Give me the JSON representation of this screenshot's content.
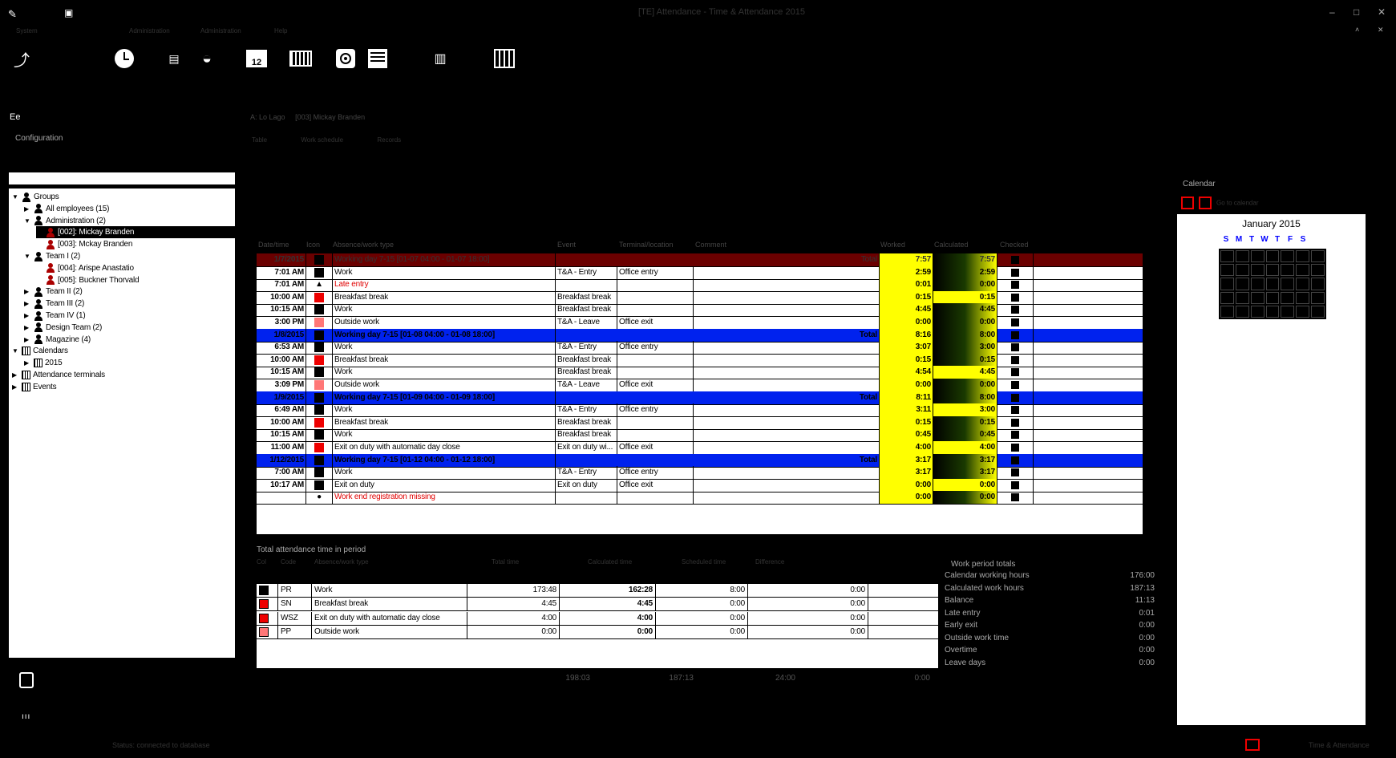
{
  "window": {
    "title": "[TE] Attendance - Time & Attendance 2015"
  },
  "menu": [
    "System",
    "Administration",
    "Administration",
    "Help"
  ],
  "nav": {
    "section": "Configuration",
    "breadcrumb_icon": "Ee",
    "page": "A: Lo Lago",
    "page2": "[003] Mickay Branden",
    "links": [
      "Table",
      "Work schedule",
      "Records"
    ]
  },
  "tree": [
    {
      "label": "Groups",
      "indent": 0,
      "icon": "person",
      "chev": "v"
    },
    {
      "label": "All employees (15)",
      "indent": 1,
      "icon": "person",
      "chev": ">"
    },
    {
      "label": "Administration (2)",
      "indent": 1,
      "icon": "person",
      "chev": "v"
    },
    {
      "label": "[002]: Mickay Branden",
      "indent": 2,
      "icon": "person-red",
      "sel": true
    },
    {
      "label": "[003]: Mckay Branden",
      "indent": 2,
      "icon": "person-red"
    },
    {
      "label": "Team I (2)",
      "indent": 1,
      "icon": "person",
      "chev": "v"
    },
    {
      "label": "[004]: Arispe Anastatio",
      "indent": 2,
      "icon": "person-red"
    },
    {
      "label": "[005]: Buckner Thorvald",
      "indent": 2,
      "icon": "person-red"
    },
    {
      "label": "Team II (2)",
      "indent": 1,
      "icon": "person",
      "chev": ">"
    },
    {
      "label": "Team III (2)",
      "indent": 1,
      "icon": "person",
      "chev": ">"
    },
    {
      "label": "Team IV (1)",
      "indent": 1,
      "icon": "person",
      "chev": ">"
    },
    {
      "label": "Design Team (2)",
      "indent": 1,
      "icon": "person",
      "chev": ">"
    },
    {
      "label": "Magazine (4)",
      "indent": 1,
      "icon": "person",
      "chev": ">"
    },
    {
      "label": "Calendars",
      "indent": 0,
      "icon": "calendar",
      "chev": "v"
    },
    {
      "label": "2015",
      "indent": 1,
      "icon": "calendar",
      "chev": ">"
    },
    {
      "label": "Attendance terminals",
      "indent": 0,
      "icon": "terminal",
      "chev": ">"
    },
    {
      "label": "Events",
      "indent": 0,
      "icon": "events",
      "chev": ">"
    }
  ],
  "records": {
    "columns": [
      "Date/time",
      "Icon",
      "Absence/work type",
      "Event",
      "Terminal/location",
      "Comment",
      "Worked",
      "Calculated",
      "Checked"
    ],
    "rows": [
      {
        "kind": "head-dark",
        "date": "1/7/2015",
        "type": "Working day 7-15 [01-07 04:00 - 01-07 18:00]",
        "total": "Total",
        "worked": "7:57",
        "calc": "7:57"
      },
      {
        "kind": "row",
        "time": "7:01 AM",
        "sq": "#000",
        "type": "Work",
        "event": "T&A - Entry",
        "loc": "Office entry",
        "worked": "2:59",
        "calc": "2:59"
      },
      {
        "kind": "row",
        "time": "7:01 AM",
        "sq": "tri",
        "type": "Late entry",
        "red": true,
        "worked": "0:01",
        "calc": "0:00"
      },
      {
        "kind": "row",
        "time": "10:00 AM",
        "sq": "#e00",
        "type": "Breakfast break",
        "event": "Breakfast break",
        "worked": "0:15",
        "calc": "0:15"
      },
      {
        "kind": "row",
        "time": "10:15 AM",
        "sq": "#000",
        "type": "Work",
        "event": "Breakfast break",
        "worked": "4:45",
        "calc": "4:45"
      },
      {
        "kind": "row",
        "time": "3:00 PM",
        "sq": "#f77",
        "type": "Outside work",
        "event": "T&A - Leave",
        "loc": "Office exit",
        "worked": "0:00",
        "calc": "0:00"
      },
      {
        "kind": "head",
        "date": "1/8/2015",
        "type": "Working day 7-15 [01-08 04:00 - 01-08 18:00]",
        "total": "Total",
        "worked": "8:16",
        "calc": "8:00"
      },
      {
        "kind": "row",
        "time": "6:53 AM",
        "sq": "#000",
        "type": "Work",
        "event": "T&A - Entry",
        "loc": "Office entry",
        "worked": "3:07",
        "calc": "3:00"
      },
      {
        "kind": "row",
        "time": "10:00 AM",
        "sq": "#e00",
        "type": "Breakfast break",
        "event": "Breakfast break",
        "worked": "0:15",
        "calc": "0:15"
      },
      {
        "kind": "row",
        "time": "10:15 AM",
        "sq": "#000",
        "type": "Work",
        "event": "Breakfast break",
        "worked": "4:54",
        "calc": "4:45"
      },
      {
        "kind": "row",
        "time": "3:09 PM",
        "sq": "#f77",
        "type": "Outside work",
        "event": "T&A - Leave",
        "loc": "Office exit",
        "worked": "0:00",
        "calc": "0:00"
      },
      {
        "kind": "head",
        "date": "1/9/2015",
        "type": "Working day 7-15 [01-09 04:00 - 01-09 18:00]",
        "total": "Total",
        "worked": "8:11",
        "calc": "8:00"
      },
      {
        "kind": "row",
        "time": "6:49 AM",
        "sq": "#000",
        "type": "Work",
        "event": "T&A - Entry",
        "loc": "Office entry",
        "worked": "3:11",
        "calc": "3:00"
      },
      {
        "kind": "row",
        "time": "10:00 AM",
        "sq": "#e00",
        "type": "Breakfast break",
        "event": "Breakfast break",
        "worked": "0:15",
        "calc": "0:15"
      },
      {
        "kind": "row",
        "time": "10:15 AM",
        "sq": "#000",
        "type": "Work",
        "event": "Breakfast break",
        "worked": "0:45",
        "calc": "0:45"
      },
      {
        "kind": "row",
        "time": "11:00 AM",
        "sq": "#e00",
        "type": "Exit on duty with automatic day close",
        "event": "Exit on duty wi...",
        "loc": "Office exit",
        "worked": "4:00",
        "calc": "4:00"
      },
      {
        "kind": "head",
        "date": "1/12/2015",
        "type": "Working day 7-15 [01-12 04:00 - 01-12 18:00]",
        "total": "Total",
        "worked": "3:17",
        "calc": "3:17"
      },
      {
        "kind": "row",
        "time": "7:00 AM",
        "sq": "#000",
        "type": "Work",
        "event": "T&A - Entry",
        "loc": "Office entry",
        "worked": "3:17",
        "calc": "3:17"
      },
      {
        "kind": "row",
        "time": "10:17 AM",
        "sq": "#000",
        "type": "Exit on duty",
        "event": "Exit on duty",
        "loc": "Office exit",
        "worked": "0:00",
        "calc": "0:00"
      },
      {
        "kind": "row",
        "time": "",
        "sq": "circle",
        "type": "Work end registration missing",
        "red": true,
        "worked": "0:00",
        "calc": "0:00"
      }
    ]
  },
  "totals": {
    "title": "Total attendance time in period",
    "columns": [
      "Col",
      "Code",
      "Absence/work type",
      "Total time",
      "Calculated time",
      "Scheduled time",
      "Difference"
    ],
    "rows": [
      {
        "sq": "#000",
        "code": "PR",
        "type": "Work",
        "t1": "173:48",
        "t2": "162:28",
        "t3": "8:00",
        "t4": "0:00"
      },
      {
        "sq": "#e00",
        "code": "SN",
        "type": "Breakfast break",
        "t1": "4:45",
        "t2": "4:45",
        "t3": "0:00",
        "t4": "0:00"
      },
      {
        "sq": "#e00",
        "code": "WSZ",
        "type": "Exit on duty with automatic day close",
        "t1": "4:00",
        "t2": "4:00",
        "t3": "0:00",
        "t4": "0:00"
      },
      {
        "sq": "#f77",
        "code": "PP",
        "type": "Outside work",
        "t1": "0:00",
        "t2": "0:00",
        "t3": "0:00",
        "t4": "0:00"
      }
    ],
    "sums": [
      "198:03",
      "187:13",
      "24:00",
      "0:00"
    ]
  },
  "work_period": {
    "title": "Work period totals",
    "rows": [
      {
        "label": "Calendar working hours",
        "value": "176:00"
      },
      {
        "label": "Calculated work hours",
        "value": "187:13"
      },
      {
        "label": "Balance",
        "value": "11:13"
      },
      {
        "label": "Late entry",
        "value": "0:01"
      },
      {
        "label": "Early exit",
        "value": "0:00"
      },
      {
        "label": "Outside work time",
        "value": "0:00"
      },
      {
        "label": "Overtime",
        "value": "0:00"
      },
      {
        "label": "Leave days",
        "value": "0:00"
      }
    ]
  },
  "calendar": {
    "title": "Calendar",
    "month": "January 2015",
    "dow": [
      "S",
      "M",
      "T",
      "W",
      "T",
      "F",
      "S"
    ],
    "link": "Go to calendar"
  },
  "status": {
    "left": "Status: connected to database",
    "right": "Time & Attendance"
  }
}
